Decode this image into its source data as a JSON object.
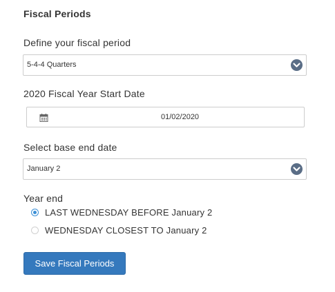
{
  "section": {
    "title": "Fiscal Periods"
  },
  "fiscal_period": {
    "label": "Define your fiscal period",
    "value": "5-4-4 Quarters"
  },
  "start_date": {
    "label": "2020 Fiscal Year Start Date",
    "value": "01/02/2020",
    "icon": "calendar-icon"
  },
  "base_end_date": {
    "label": "Select base end date",
    "value": "January 2"
  },
  "year_end": {
    "label": "Year end",
    "options": [
      {
        "label": "LAST WEDNESDAY BEFORE January 2",
        "selected": true
      },
      {
        "label": "WEDNESDAY CLOSEST TO January 2",
        "selected": false
      }
    ]
  },
  "actions": {
    "save_label": "Save Fiscal Periods"
  },
  "colors": {
    "accent": "#3579bd",
    "dropdown_icon": "#5a6d86",
    "radio_selected": "#3b8fd6"
  }
}
